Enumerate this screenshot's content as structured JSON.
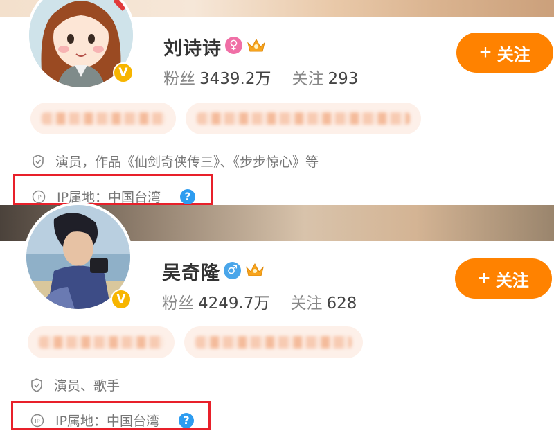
{
  "profiles": [
    {
      "name": "刘诗诗",
      "gender_symbol": "♀",
      "gender_color": "#f06fa6",
      "followers_label": "粉丝",
      "followers": "3439.2万",
      "following_label": "关注",
      "following": "293",
      "follow_button": "关注",
      "description": "演员，作品《仙剑奇侠传三》、《步步惊心》等",
      "ip_label": "IP属地：中国台湾",
      "verify_badge": "V",
      "help_symbol": "?"
    },
    {
      "name": "吴奇隆",
      "gender_symbol": "♂",
      "gender_color": "#4aa6ea",
      "followers_label": "粉丝",
      "followers": "4249.7万",
      "following_label": "关注",
      "following": "628",
      "follow_button": "关注",
      "description": "演员、歌手",
      "ip_label": "IP属地：中国台湾",
      "verify_badge": "V",
      "help_symbol": "?"
    }
  ],
  "colors": {
    "follow_button": "#ff8200",
    "highlight_box": "#e8202a",
    "help_icon": "#2d9cf0",
    "verified_badge": "#f7b500"
  }
}
